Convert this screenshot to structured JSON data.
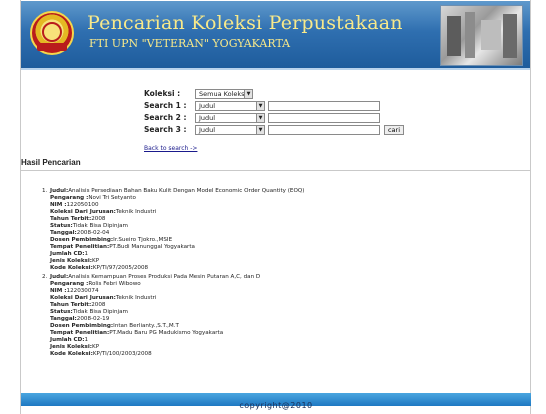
{
  "header": {
    "title": "Pencarian Koleksi Perpustakaan",
    "subtitle": "FTI UPN \"VETERAN\" YOGYAKARTA"
  },
  "search": {
    "koleksi_label": "Koleksi :",
    "koleksi_value": "Semua Koleksi",
    "search1_label": "Search 1 :",
    "search1_field": "Judul",
    "search1_value": "",
    "search2_label": "Search 2 :",
    "search2_field": "Judul",
    "search2_value": "",
    "search3_label": "Search 3 :",
    "search3_field": "Judul",
    "search3_value": "",
    "submit_label": "cari",
    "back_link": "Back to search ->"
  },
  "results": {
    "heading": "Hasil Pencarian",
    "items": [
      {
        "num": "1.",
        "judul_label": "Judul:",
        "judul": "Analisis Persediaan Bahan Baku Kulit Dengan Model Economic Order Quantity (EOQ)",
        "pengarang_label": "Pengarang :",
        "pengarang": "Novi Tri Setyanto",
        "nim_label": "NIM :",
        "nim": "122050100",
        "jurusan_label": "Koleksi Dari Jurusan:",
        "jurusan": "Teknik Industri",
        "tahun_label": "Tahun Terbit:",
        "tahun": "2008",
        "status_label": "Status:",
        "status": "Tidak Bisa Dipinjam",
        "tanggal_label": "Tanggal:",
        "tanggal": "2008-02-04",
        "dosen_label": "Dosen Pembimbing:",
        "dosen": "Ir.Sueiro Tjokro.,MSIE",
        "tempat_label": "Tempat Penelitian:",
        "tempat": "PT.Budi Manunggal Yogyakarta",
        "cd_label": "Jumlah CD:",
        "cd": "1",
        "jenis_label": "Jenis Koleksi:",
        "jenis": "KP",
        "kode_label": "Kode Koleksi:",
        "kode": "KP/TI/97/2005/2008"
      },
      {
        "num": "2.",
        "judul_label": "Judul:",
        "judul": "Analisis Kemampuan Proses Produksi Pada Mesin Putaran A,C, dan D",
        "pengarang_label": "Pengarang :",
        "pengarang": "Rolis Febri Wibowo",
        "nim_label": "NIM :",
        "nim": "122030074",
        "jurusan_label": "Koleksi Dari Jurusan:",
        "jurusan": "Teknik Industri",
        "tahun_label": "Tahun Terbit:",
        "tahun": "2008",
        "status_label": "Status:",
        "status": "Tidak Bisa Dipinjam",
        "tanggal_label": "Tanggal:",
        "tanggal": "2008-02-19",
        "dosen_label": "Dosen Pembimbing:",
        "dosen": "Intan Berlianty.,S.T.,M.T",
        "tempat_label": "Tempat Penelitian:",
        "tempat": "PT.Madu Baru PG Madukismo Yogyakarta",
        "cd_label": "Jumlah CD:",
        "cd": "1",
        "jenis_label": "Jenis Koleksi:",
        "jenis": "KP",
        "kode_label": "Kode Koleksi:",
        "kode": "KP/TI/100/2003/2008"
      }
    ]
  },
  "footer": {
    "copyright": "copyright@2010"
  },
  "colors": {
    "header_blue": "#2f6fb0",
    "title_yellow": "#f8e98a",
    "footer_blue": "#1e78c2"
  }
}
